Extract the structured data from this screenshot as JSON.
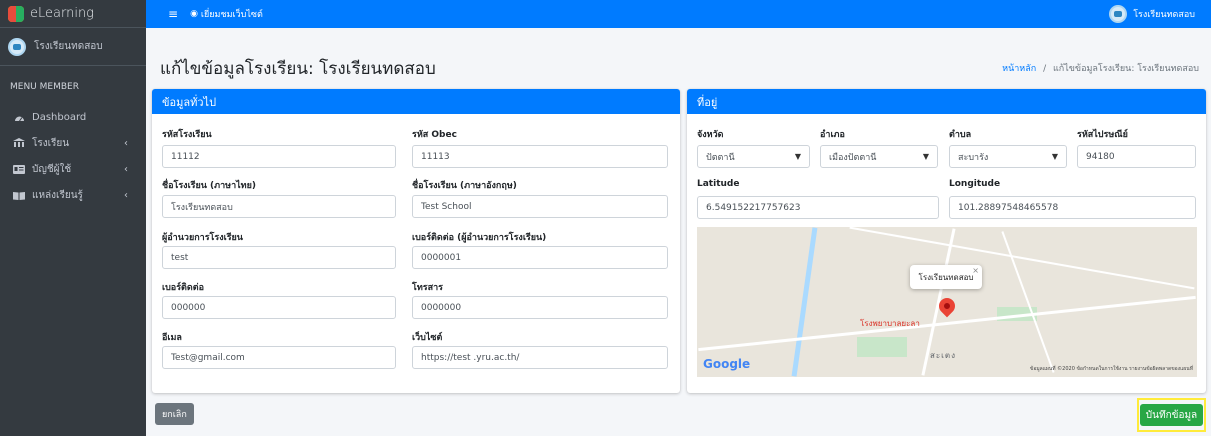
{
  "brand": {
    "name": "eLearning"
  },
  "sidebar": {
    "user_name": "โรงเรียนทดสอบ",
    "menu_header": "MENU MEMBER",
    "items": [
      {
        "label": "Dashboard",
        "icon": "dashboard-icon",
        "has_children": false
      },
      {
        "label": "โรงเรียน",
        "icon": "school-icon",
        "has_children": true
      },
      {
        "label": "บัญชีผู้ใช้",
        "icon": "user-card-icon",
        "has_children": true
      },
      {
        "label": "แหล่งเรียนรู้",
        "icon": "book-icon",
        "has_children": true
      }
    ]
  },
  "topbar": {
    "menu_icon": "hamburger-icon",
    "view_site": "เยี่ยมชมเว็บไซต์",
    "user_name": "โรงเรียนทดสอบ"
  },
  "page": {
    "title": "แก้ไขข้อมูลโรงเรียน: โรงเรียนทดสอบ",
    "breadcrumb_home": "หน้าหลัก",
    "breadcrumb_sep": "/",
    "breadcrumb_current": "แก้ไขข้อมูลโรงเรียน: โรงเรียนทดสอบ"
  },
  "general": {
    "heading": "ข้อมูลทั่วไป",
    "school_code": {
      "label": "รหัสโรงเรียน",
      "value": "11112"
    },
    "obec_code": {
      "label": "รหัส Obec",
      "value": "11113"
    },
    "name_th": {
      "label": "ชื่อโรงเรียน (ภาษาไทย)",
      "value": "โรงเรียนทดสอบ"
    },
    "name_en": {
      "label": "ชื่อโรงเรียน (ภาษาอังกฤษ)",
      "value": "Test School"
    },
    "director": {
      "label": "ผู้อำนวยการโรงเรียน",
      "value": "test"
    },
    "director_phone": {
      "label": "เบอร์ติดต่อ (ผู้อำนวยการโรงเรียน)",
      "value": "0000001"
    },
    "phone": {
      "label": "เบอร์ติดต่อ",
      "value": "000000"
    },
    "fax": {
      "label": "โทรสาร",
      "value": "0000000"
    },
    "email": {
      "label": "อีเมล",
      "value": "Test@gmail.com"
    },
    "website": {
      "label": "เว็บไซต์",
      "value": "https://test .yru.ac.th/"
    }
  },
  "address": {
    "heading": "ที่อยู่",
    "province": {
      "label": "จังหวัด",
      "value": "ปัตตานี"
    },
    "district": {
      "label": "อำเภอ",
      "value": "เมืองปัตตานี"
    },
    "subdistrict": {
      "label": "ตำบล",
      "value": "สะบารัง"
    },
    "postcode": {
      "label": "รหัสไปรษณีย์",
      "value": "94180"
    },
    "latitude": {
      "label": "Latitude",
      "value": "6.549152217757623"
    },
    "longitude": {
      "label": "Longitude",
      "value": "101.28897548465578"
    }
  },
  "map": {
    "popup_label": "โรงเรียนทดสอบ",
    "poi_label": "โรงพยาบาลยะลา",
    "place_label": "สะเตง",
    "google": "Google",
    "credit": "ข้อมูลแผนที่ ©2020   ข้อกำหนดในการใช้งาน   รายงานข้อผิดพลาดของแผนที่"
  },
  "buttons": {
    "cancel": "ยกเลิก",
    "save": "บันทึกข้อมูล"
  },
  "colors": {
    "primary": "#007bff",
    "sidebar": "#343a40",
    "success": "#28a745",
    "secondary": "#6c757d",
    "highlight": "#ffeb3b"
  }
}
